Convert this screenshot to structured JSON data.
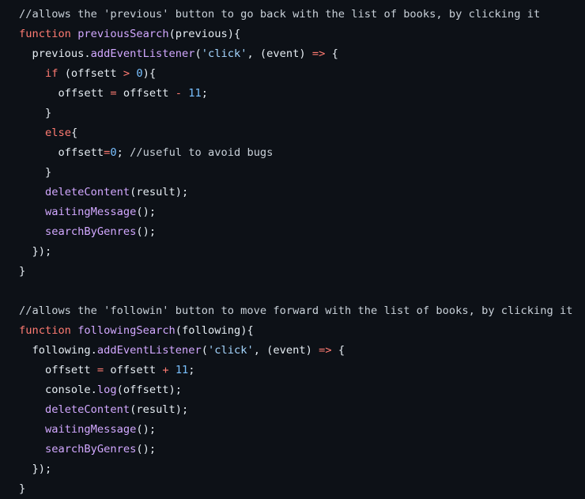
{
  "code": {
    "lines": [
      [
        {
          "t": "//allows the 'previous' button to go back with the list of books, by clicking it",
          "k": "comment"
        }
      ],
      [
        {
          "t": "function",
          "k": "keyword"
        },
        {
          "t": " ",
          "k": "plain"
        },
        {
          "t": "previousSearch",
          "k": "fname"
        },
        {
          "t": "(previous){",
          "k": "plain"
        }
      ],
      [
        {
          "t": "  previous.",
          "k": "plain"
        },
        {
          "t": "addEventListener",
          "k": "fname"
        },
        {
          "t": "(",
          "k": "plain"
        },
        {
          "t": "'click'",
          "k": "string"
        },
        {
          "t": ", (event) ",
          "k": "plain"
        },
        {
          "t": "=>",
          "k": "op"
        },
        {
          "t": " {",
          "k": "plain"
        }
      ],
      [
        {
          "t": "    ",
          "k": "plain"
        },
        {
          "t": "if",
          "k": "keyword"
        },
        {
          "t": " (offsett ",
          "k": "plain"
        },
        {
          "t": ">",
          "k": "op"
        },
        {
          "t": " ",
          "k": "plain"
        },
        {
          "t": "0",
          "k": "number"
        },
        {
          "t": "){",
          "k": "plain"
        }
      ],
      [
        {
          "t": "      offsett ",
          "k": "plain"
        },
        {
          "t": "=",
          "k": "op"
        },
        {
          "t": " offsett ",
          "k": "plain"
        },
        {
          "t": "-",
          "k": "op"
        },
        {
          "t": " ",
          "k": "plain"
        },
        {
          "t": "11",
          "k": "number"
        },
        {
          "t": ";",
          "k": "plain"
        }
      ],
      [
        {
          "t": "    }",
          "k": "plain"
        }
      ],
      [
        {
          "t": "    ",
          "k": "plain"
        },
        {
          "t": "else",
          "k": "keyword"
        },
        {
          "t": "{",
          "k": "plain"
        }
      ],
      [
        {
          "t": "      offsett",
          "k": "plain"
        },
        {
          "t": "=",
          "k": "op"
        },
        {
          "t": "0",
          "k": "number"
        },
        {
          "t": "; ",
          "k": "plain"
        },
        {
          "t": "//useful to avoid bugs",
          "k": "comment"
        }
      ],
      [
        {
          "t": "    }",
          "k": "plain"
        }
      ],
      [
        {
          "t": "    ",
          "k": "plain"
        },
        {
          "t": "deleteContent",
          "k": "fname"
        },
        {
          "t": "(result);",
          "k": "plain"
        }
      ],
      [
        {
          "t": "    ",
          "k": "plain"
        },
        {
          "t": "waitingMessage",
          "k": "fname"
        },
        {
          "t": "();",
          "k": "plain"
        }
      ],
      [
        {
          "t": "    ",
          "k": "plain"
        },
        {
          "t": "searchByGenres",
          "k": "fname"
        },
        {
          "t": "();",
          "k": "plain"
        }
      ],
      [
        {
          "t": "  });",
          "k": "plain"
        }
      ],
      [
        {
          "t": "}",
          "k": "plain"
        }
      ],
      [],
      [
        {
          "t": "//allows the 'followin' button to move forward with the list of books, by clicking it",
          "k": "comment"
        }
      ],
      [
        {
          "t": "function",
          "k": "keyword"
        },
        {
          "t": " ",
          "k": "plain"
        },
        {
          "t": "followingSearch",
          "k": "fname"
        },
        {
          "t": "(following){",
          "k": "plain"
        }
      ],
      [
        {
          "t": "  following.",
          "k": "plain"
        },
        {
          "t": "addEventListener",
          "k": "fname"
        },
        {
          "t": "(",
          "k": "plain"
        },
        {
          "t": "'click'",
          "k": "string"
        },
        {
          "t": ", (event) ",
          "k": "plain"
        },
        {
          "t": "=>",
          "k": "op"
        },
        {
          "t": " {",
          "k": "plain"
        }
      ],
      [
        {
          "t": "    offsett ",
          "k": "plain"
        },
        {
          "t": "=",
          "k": "op"
        },
        {
          "t": " offsett ",
          "k": "plain"
        },
        {
          "t": "+",
          "k": "op"
        },
        {
          "t": " ",
          "k": "plain"
        },
        {
          "t": "11",
          "k": "number"
        },
        {
          "t": ";",
          "k": "plain"
        }
      ],
      [
        {
          "t": "    console.",
          "k": "plain"
        },
        {
          "t": "log",
          "k": "fname"
        },
        {
          "t": "(offsett);",
          "k": "plain"
        }
      ],
      [
        {
          "t": "    ",
          "k": "plain"
        },
        {
          "t": "deleteContent",
          "k": "fname"
        },
        {
          "t": "(result);",
          "k": "plain"
        }
      ],
      [
        {
          "t": "    ",
          "k": "plain"
        },
        {
          "t": "waitingMessage",
          "k": "fname"
        },
        {
          "t": "();",
          "k": "plain"
        }
      ],
      [
        {
          "t": "    ",
          "k": "plain"
        },
        {
          "t": "searchByGenres",
          "k": "fname"
        },
        {
          "t": "();",
          "k": "plain"
        }
      ],
      [
        {
          "t": "  });",
          "k": "plain"
        }
      ],
      [
        {
          "t": "}",
          "k": "plain"
        }
      ]
    ]
  },
  "colors": {
    "background": "#0d1117",
    "comment": "#c9d1d9",
    "keyword": "#ff7b72",
    "function_name": "#d2a8ff",
    "plain": "#e6edf3",
    "string": "#a5d6ff",
    "number": "#79c0ff",
    "operator": "#ff7b72"
  }
}
